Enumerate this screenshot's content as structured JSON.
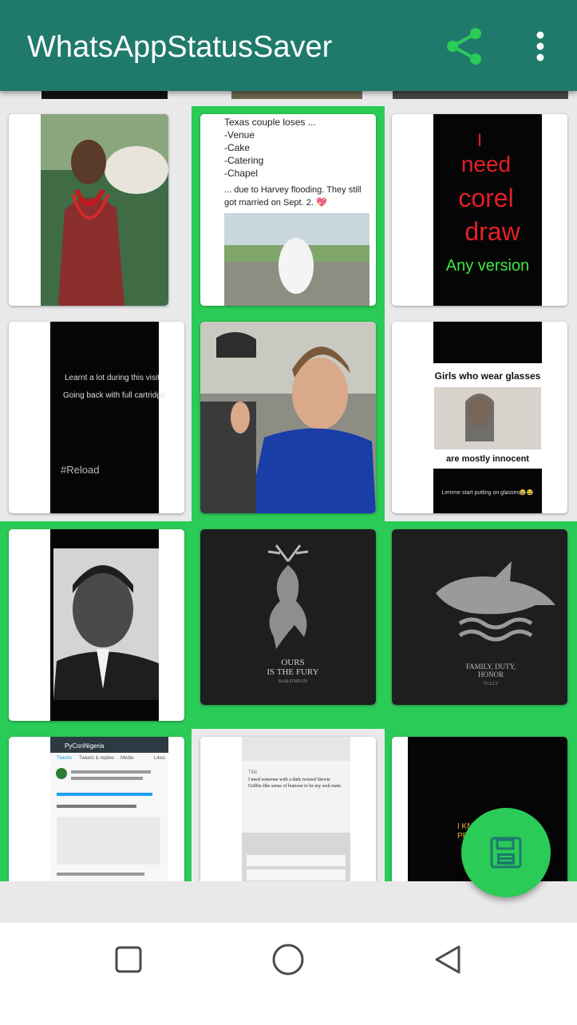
{
  "app": {
    "title": "WhatsAppStatusSaver"
  },
  "toolbar": {
    "share_icon": "share-icon",
    "more_icon": "more-vert-icon"
  },
  "colors": {
    "app_bar": "#1f7a6c",
    "accent": "#2bcb57",
    "background": "#e9e9e9"
  },
  "statuses": [
    {
      "index": 1,
      "kind": "image",
      "selected": false
    },
    {
      "index": 2,
      "kind": "image",
      "selected": true,
      "lines": [
        "Texas couple loses ...",
        "-Venue",
        "-Cake",
        "-Catering",
        "-Chapel",
        "... due to Harvey flooding. They still",
        "got married on Sept. 2. 💖"
      ]
    },
    {
      "index": 3,
      "kind": "image",
      "selected": false,
      "lines": [
        "I",
        "need",
        "corel",
        "draw",
        "Any version"
      ]
    },
    {
      "index": 4,
      "kind": "image",
      "selected": false,
      "lines": [
        "Learnt a lot during this visit.",
        "Going back with full cartridge",
        "#Reload"
      ]
    },
    {
      "index": 5,
      "kind": "image",
      "selected": true
    },
    {
      "index": 6,
      "kind": "image",
      "selected": false,
      "lines": [
        "Girls who wear glasses",
        "are mostly innocent",
        "Lemme start putting on glasses😂😂"
      ]
    },
    {
      "index": 7,
      "kind": "image",
      "selected": true
    },
    {
      "index": 8,
      "kind": "image",
      "selected": true,
      "lines": [
        "OURS",
        "IS THE FURY",
        "BARATHEON"
      ]
    },
    {
      "index": 9,
      "kind": "image",
      "selected": true,
      "lines": [
        "FAMILY, DUTY,",
        "HONOR",
        "TULLY"
      ]
    },
    {
      "index": 10,
      "kind": "image",
      "selected": true,
      "lines": [
        "PyConNigeria",
        "Tweets",
        "Tweets & replies",
        "Media",
        "Likes"
      ]
    },
    {
      "index": 11,
      "kind": "image",
      "selected": false,
      "lines": [
        "Title",
        "I need someone with a dark twisted Stewie Griffin-like sense of humour to be my soul mate."
      ]
    },
    {
      "index": 12,
      "kind": "image",
      "selected": true,
      "lines": [
        "I KN",
        "PE",
        "M"
      ]
    }
  ],
  "fab": {
    "icon": "save-icon"
  },
  "navigation": {
    "recents_icon": "square-icon",
    "home_icon": "circle-icon",
    "back_icon": "triangle-back-icon"
  }
}
